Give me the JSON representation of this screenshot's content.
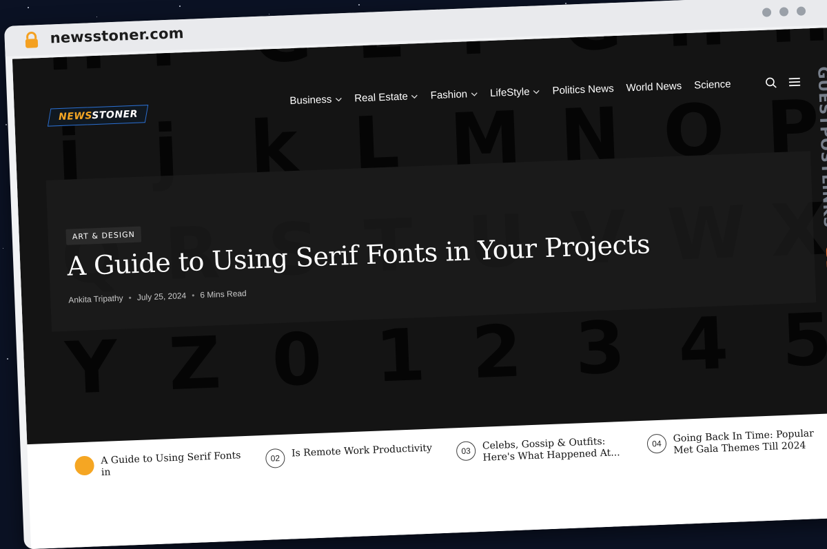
{
  "browser": {
    "url": "newsstoner.com",
    "lock_icon": "lock-icon"
  },
  "site": {
    "logo_part1": "NEWS",
    "logo_part2": "STONER"
  },
  "nav": {
    "items": [
      {
        "label": "Business",
        "dropdown": true
      },
      {
        "label": "Real Estate",
        "dropdown": true
      },
      {
        "label": "Fashion",
        "dropdown": true
      },
      {
        "label": "LifeStyle",
        "dropdown": true
      },
      {
        "label": "Politics News",
        "dropdown": false
      },
      {
        "label": "World News",
        "dropdown": false
      },
      {
        "label": "Science",
        "dropdown": false
      }
    ],
    "search_icon": "search-icon",
    "menu_icon": "menu-icon"
  },
  "hero": {
    "category": "ART & DESIGN",
    "title": "A Guide to Using Serif Fonts in Your Projects",
    "author": "Ankita Tripathy",
    "date": "July 25, 2024",
    "read_time": "6 Mins Read"
  },
  "watermark": {
    "text": "GUESTPOSTLINKS"
  },
  "trending": [
    {
      "num": "",
      "title": "A Guide to Using Serif Fonts in"
    },
    {
      "num": "02",
      "title": "Is Remote Work Productivity"
    },
    {
      "num": "03",
      "title": "Celebs, Gossip & Outfits: Here's What Happened At..."
    },
    {
      "num": "04",
      "title": "Going Back In Time: Popular Met Gala Themes Till 2024"
    }
  ],
  "colors": {
    "accent": "#f5a623",
    "hero_bg": "#141414",
    "watermark_orange": "#f26b2a"
  }
}
